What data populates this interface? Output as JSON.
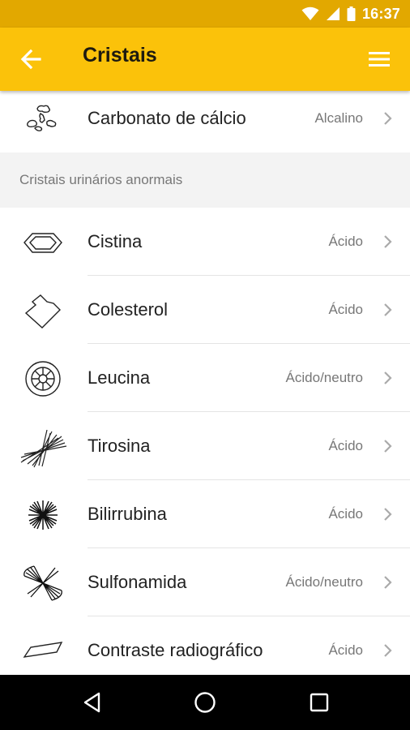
{
  "status_bar": {
    "time": "16:37"
  },
  "app_bar": {
    "title": "Cristais"
  },
  "first_item": {
    "label": "Carbonato de cálcio",
    "tag": "Alcalino",
    "icon": "calcium-carbonate-icon"
  },
  "section": {
    "title": "Cristais urinários anormais"
  },
  "items": [
    {
      "label": "Cistina",
      "tag": "Ácido",
      "icon": "cystine-icon"
    },
    {
      "label": "Colesterol",
      "tag": "Ácido",
      "icon": "cholesterol-icon"
    },
    {
      "label": "Leucina",
      "tag": "Ácido/neutro",
      "icon": "leucine-icon"
    },
    {
      "label": "Tirosina",
      "tag": "Ácido",
      "icon": "tyrosine-icon"
    },
    {
      "label": "Bilirrubina",
      "tag": "Ácido",
      "icon": "bilirubin-icon"
    },
    {
      "label": "Sulfonamida",
      "tag": "Ácido/neutro",
      "icon": "sulfonamide-icon"
    },
    {
      "label": "Contraste radiográfico",
      "tag": "Ácido",
      "icon": "radiographic-contrast-icon"
    }
  ],
  "colors": {
    "status_bar": "#e2a800",
    "app_bar": "#fbc20a",
    "section_bg": "#f3f3f3"
  }
}
